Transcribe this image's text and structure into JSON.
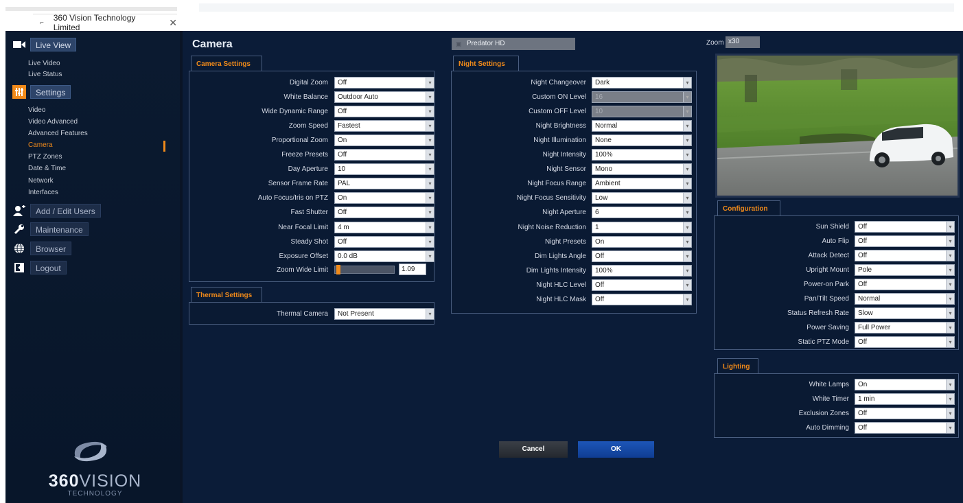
{
  "browser": {
    "tab_title": "360 Vision Technology Limited",
    "close_glyph": "✕"
  },
  "sidebar": {
    "live_view": {
      "label": "Live View",
      "icon": "video-camera-icon"
    },
    "live_items": [
      "Live Video",
      "Live Status"
    ],
    "settings": {
      "label": "Settings",
      "icon": "sliders-icon"
    },
    "settings_items": [
      "Video",
      "Video Advanced",
      "Advanced Features",
      "Camera",
      "PTZ Zones",
      "Date & Time",
      "Network",
      "Interfaces"
    ],
    "active_item": "Camera",
    "add_edit_users": {
      "label": "Add / Edit Users",
      "icon": "add-user-icon"
    },
    "maintenance": {
      "label": "Maintenance",
      "icon": "wrench-icon"
    },
    "browser": {
      "label": "Browser",
      "icon": "globe-icon"
    },
    "logout": {
      "label": "Logout",
      "icon": "logout-icon"
    },
    "logo": {
      "brand_bold": "360",
      "brand_rest": "VISION",
      "sub": "TECHNOLOGY"
    }
  },
  "page": {
    "title": "Camera",
    "device": "Predator HD",
    "zoom_label": "Zoom",
    "zoom_value": "x30"
  },
  "camera_settings": {
    "tab": "Camera Settings",
    "rows": [
      {
        "label": "Digital Zoom",
        "value": "Off"
      },
      {
        "label": "White Balance",
        "value": "Outdoor Auto"
      },
      {
        "label": "Wide Dynamic Range",
        "value": "Off"
      },
      {
        "label": "Zoom Speed",
        "value": "Fastest"
      },
      {
        "label": "Proportional Zoom",
        "value": "On"
      },
      {
        "label": "Freeze Presets",
        "value": "Off"
      },
      {
        "label": "Day Aperture",
        "value": "10"
      },
      {
        "label": "Sensor Frame Rate",
        "value": "PAL"
      },
      {
        "label": "Auto Focus/Iris on PTZ",
        "value": "On"
      },
      {
        "label": "Fast Shutter",
        "value": "Off"
      },
      {
        "label": "Near Focal Limit",
        "value": "4 m"
      },
      {
        "label": "Steady Shot",
        "value": "Off"
      },
      {
        "label": "Exposure Offset",
        "value": "0.0 dB"
      }
    ],
    "zoom_wide_limit": {
      "label": "Zoom Wide Limit",
      "value": "1.09",
      "fraction": 0.03
    }
  },
  "thermal_settings": {
    "tab": "Thermal Settings",
    "label": "Thermal Camera",
    "value": "Not Present"
  },
  "night_settings": {
    "tab": "Night Settings",
    "rows": [
      {
        "label": "Night Changeover",
        "value": "Dark",
        "disabled": false
      },
      {
        "label": "Custom ON Level",
        "value": "16",
        "disabled": true
      },
      {
        "label": "Custom OFF Level",
        "value": "10",
        "disabled": true
      },
      {
        "label": "Night Brightness",
        "value": "Normal",
        "disabled": false
      },
      {
        "label": "Night Illumination",
        "value": "None",
        "disabled": false
      },
      {
        "label": "Night Intensity",
        "value": "100%",
        "disabled": false
      },
      {
        "label": "Night Sensor",
        "value": "Mono",
        "disabled": false
      },
      {
        "label": "Night Focus Range",
        "value": "Ambient",
        "disabled": false
      },
      {
        "label": "Night Focus Sensitivity",
        "value": "Low",
        "disabled": false
      },
      {
        "label": "Night Aperture",
        "value": "6",
        "disabled": false
      },
      {
        "label": "Night Noise Reduction",
        "value": "1",
        "disabled": false
      },
      {
        "label": "Night Presets",
        "value": "On",
        "disabled": false
      },
      {
        "label": "Dim Lights Angle",
        "value": "Off",
        "disabled": false
      },
      {
        "label": "Dim Lights Intensity",
        "value": "100%",
        "disabled": false
      },
      {
        "label": "Night HLC Level",
        "value": "Off",
        "disabled": false
      },
      {
        "label": "Night HLC Mask",
        "value": "Off",
        "disabled": false
      }
    ]
  },
  "configuration": {
    "tab": "Configuration",
    "rows": [
      {
        "label": "Sun Shield",
        "value": "Off"
      },
      {
        "label": "Auto Flip",
        "value": "Off"
      },
      {
        "label": "Attack Detect",
        "value": "Off"
      },
      {
        "label": "Upright Mount",
        "value": "Pole"
      },
      {
        "label": "Power-on Park",
        "value": "Off"
      },
      {
        "label": "Pan/Tilt Speed",
        "value": "Normal"
      },
      {
        "label": "Status Refresh Rate",
        "value": "Slow"
      },
      {
        "label": "Power Saving",
        "value": "Full Power"
      },
      {
        "label": "Static PTZ Mode",
        "value": "Off"
      }
    ]
  },
  "lighting": {
    "tab": "Lighting",
    "rows": [
      {
        "label": "White Lamps",
        "value": "On"
      },
      {
        "label": "White Timer",
        "value": "1 min"
      },
      {
        "label": "Exclusion Zones",
        "value": "Off"
      },
      {
        "label": "Auto Dimming",
        "value": "Off"
      }
    ]
  },
  "buttons": {
    "cancel": "Cancel",
    "ok": "OK"
  },
  "colors": {
    "accent": "#f08a1a",
    "ok_button": "#1d56b8",
    "background": "#0b1c38"
  }
}
